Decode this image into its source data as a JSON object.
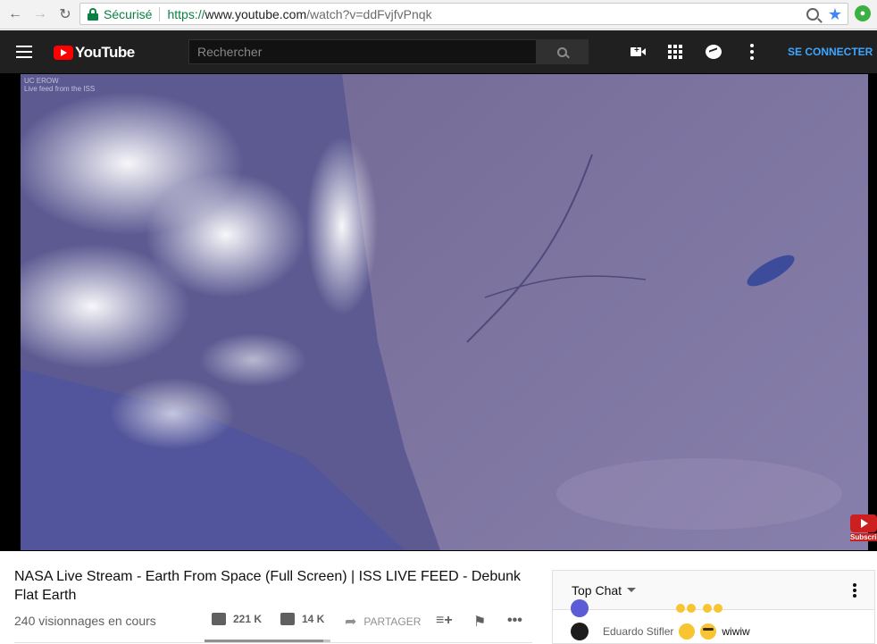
{
  "browser": {
    "secure_label": "Sécurisé",
    "url_scheme": "https://",
    "url_host": "www.youtube.com",
    "url_path": "/watch?v=ddFvjfvPnqk"
  },
  "masthead": {
    "logo_text": "YouTube",
    "search_placeholder": "Rechercher",
    "signin_label": "SE CONNECTER"
  },
  "player": {
    "overlay_line1": "UC EROW",
    "overlay_line2": "Live feed from the ISS"
  },
  "subscribe_badge": "Subscribe",
  "video": {
    "title": "NASA Live Stream - Earth From Space (Full Screen) | ISS LIVE FEED - Debunk Flat Earth",
    "views": "240 visionnages en cours",
    "likes": "221 K",
    "dislikes": "14 K",
    "share_label": "PARTAGER",
    "like_ratio": 0.94
  },
  "chat": {
    "title": "Top Chat",
    "messages": [
      {
        "author": "",
        "text": ""
      },
      {
        "author": "Eduardo Stifler",
        "text": "wiwiw"
      }
    ]
  },
  "colors": {
    "brand_red": "#ff0000",
    "secure_green": "#0b8043",
    "signin_blue": "#3ea6ff"
  }
}
